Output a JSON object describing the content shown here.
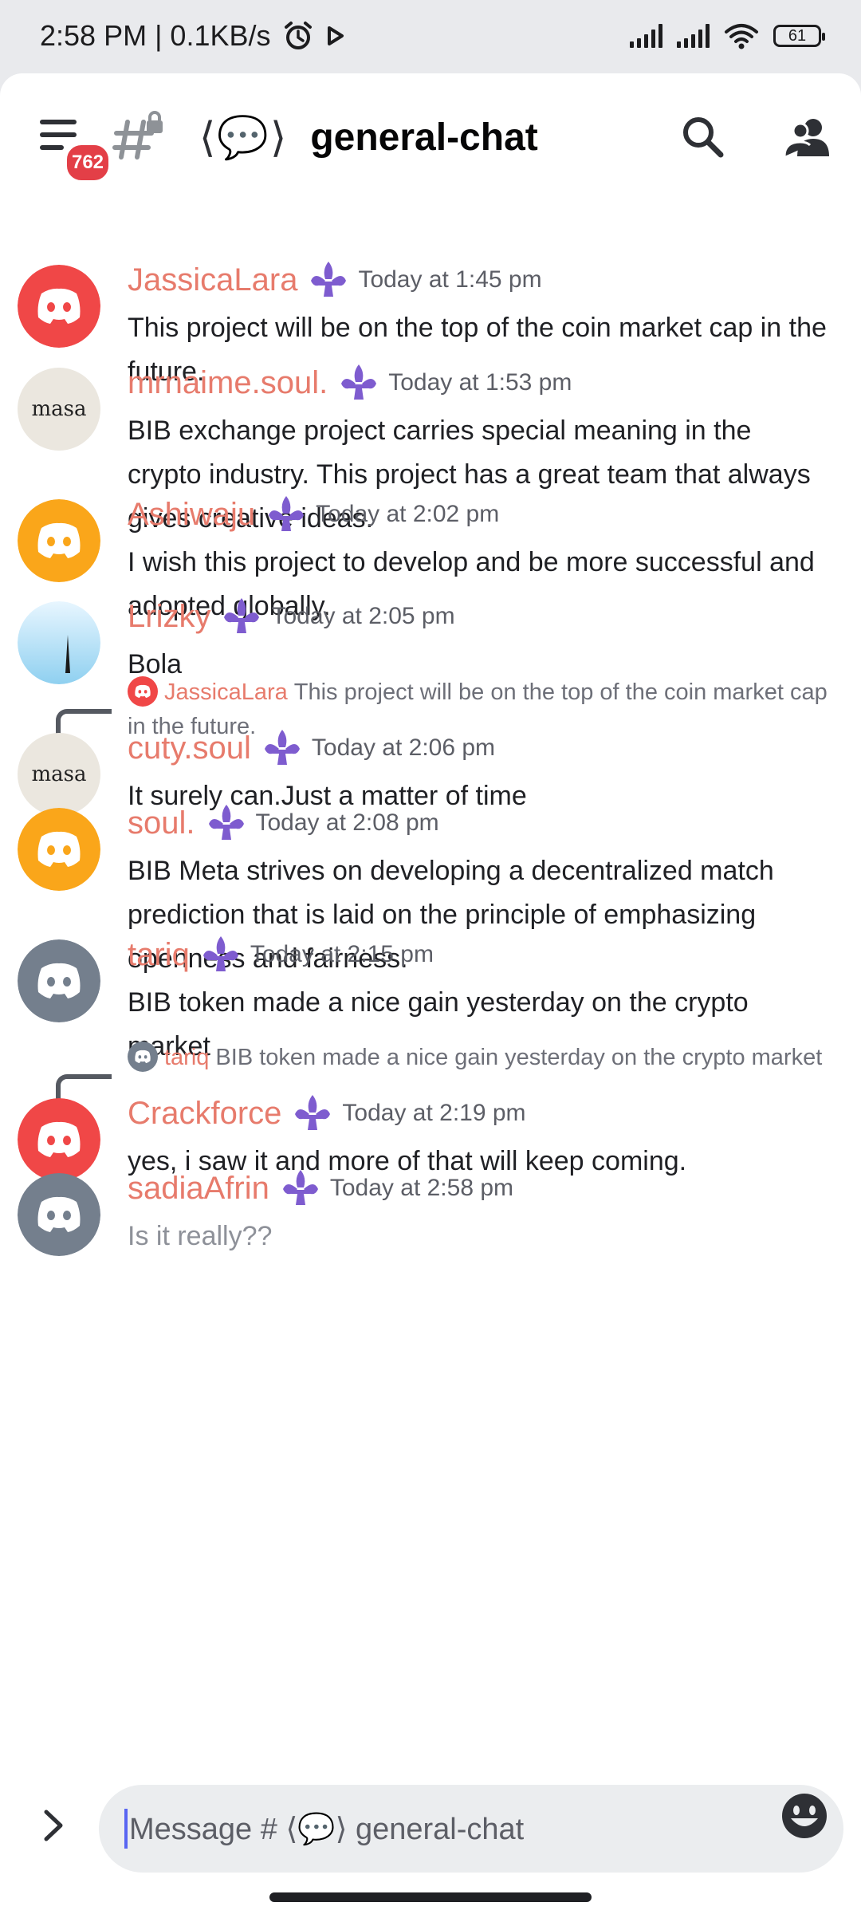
{
  "status_bar": {
    "time_speed": "2:58 PM | 0.1KB/s",
    "alarm_icon": "alarm-icon",
    "play_icon": "play-icon",
    "battery": "61"
  },
  "header": {
    "unread_badge": "762",
    "channel_emoji": "⟨💬⟩",
    "channel_name": "general-chat"
  },
  "messages": [
    {
      "author": "JassicaLara",
      "time": "Today at 1:45 pm",
      "text": "This project will be on the top of the coin market cap in the future.",
      "avatar": {
        "type": "discord",
        "color": "#f04747"
      }
    },
    {
      "author": "mrnaime.soul.",
      "time": "Today at 1:53 pm",
      "text": "BIB exchange project carries special meaning in the crypto industry.  This project has a great team that always gives creative ideas.",
      "avatar": {
        "type": "text",
        "text": "masa",
        "color": "#ebe7df"
      }
    },
    {
      "author": "Ashiwaju",
      "time": "Today at 2:02 pm",
      "text": "I wish this project to develop and be more successful and adopted globally.",
      "avatar": {
        "type": "discord",
        "color": "#faa61a"
      }
    },
    {
      "author": "Lrizky",
      "time": "Today at 2:05 pm",
      "text": "Bola",
      "avatar": {
        "type": "sky",
        "color": "#bfe3f5"
      }
    },
    {
      "author": "cuty.soul",
      "time": "Today at 2:06 pm",
      "text": "It surely can.Just a matter of time",
      "avatar": {
        "type": "text",
        "text": "masa",
        "color": "#ebe7df"
      },
      "reply": {
        "author": "JassicaLara",
        "text": "This project will be on the top of the coin market cap in the future.",
        "color": "#f04747"
      }
    },
    {
      "author": "soul.",
      "time": "Today at 2:08 pm",
      "text": "BIB Meta strives on developing a decentralized match prediction that is laid on the principle of emphasizing openness and fairness.",
      "avatar": {
        "type": "discord",
        "color": "#faa61a"
      }
    },
    {
      "author": "tariq",
      "time": "Today at 2:15 pm",
      "text": "BIB token made a nice gain yesterday on the crypto market",
      "avatar": {
        "type": "discord",
        "color": "#747f8d"
      }
    },
    {
      "author": "Crackforce",
      "time": "Today at 2:19 pm",
      "text": "yes, i saw it and more of that will keep coming.",
      "avatar": {
        "type": "discord",
        "color": "#f04747"
      },
      "reply": {
        "author": "tariq",
        "text": "BIB token made a nice gain yesterday on the crypto market",
        "color": "#747f8d"
      }
    },
    {
      "author": "sadiaAfrin",
      "time": "Today at 2:58 pm",
      "text": "Is it really??",
      "avatar": {
        "type": "discord",
        "color": "#747f8d"
      },
      "pending": true
    }
  ],
  "composer": {
    "placeholder": "Message # ⟨💬⟩  general-chat"
  },
  "colors": {
    "author": "#e77b6c",
    "accent": "#5865f2",
    "badge": "#e33f47",
    "flair": "#7e5ccf"
  }
}
